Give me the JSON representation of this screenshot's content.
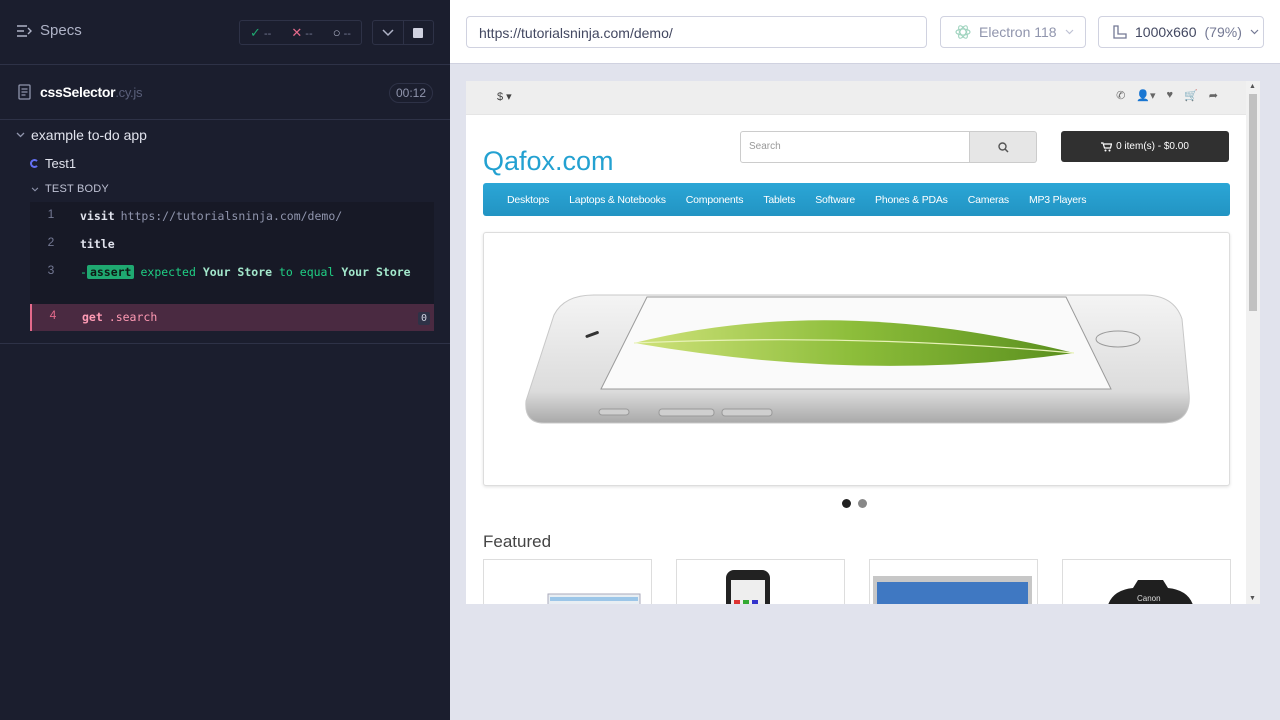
{
  "runner": {
    "specs_label": "Specs",
    "stats": {
      "passed": "--",
      "failed": "--",
      "pending": "--"
    },
    "spec_file": {
      "name": "cssSelector",
      "ext": ".cy.js",
      "duration": "00:12"
    },
    "suite_title": "example to-do app",
    "test_title": "Test1",
    "body_label": "TEST BODY",
    "commands": [
      {
        "num": "1",
        "name": "visit",
        "arg": "https://tutorialsninja.com/demo/"
      },
      {
        "num": "2",
        "name": "title",
        "arg": ""
      },
      {
        "num": "3",
        "prefix": "-",
        "name": "assert",
        "text_a": "expected",
        "value_a": "Your Store",
        "text_b": "to equal",
        "value_b": "Your",
        "value_c": "Store"
      },
      {
        "num": "4",
        "name": "get",
        "arg": ".search",
        "count": "0"
      }
    ]
  },
  "preview": {
    "url": "https://tutorialsninja.com/demo/",
    "browser": "Electron 118",
    "viewport": "1000x660",
    "zoom": "(79%)"
  },
  "site": {
    "currency": "$",
    "logo": "Qafox.com",
    "search_placeholder": "Search",
    "cart_label": "0 item(s) - $0.00",
    "nav": [
      "Desktops",
      "Laptops & Notebooks",
      "Components",
      "Tablets",
      "Software",
      "Phones & PDAs",
      "Cameras",
      "MP3 Players"
    ],
    "carousel_active_index": 0,
    "carousel_count": 2,
    "featured_title": "Featured"
  },
  "colors": {
    "runner_bg": "#1b1e2e",
    "accent_pass": "#1fa971",
    "accent_fail": "#e46a8b",
    "site_brand": "#23a1d1"
  }
}
